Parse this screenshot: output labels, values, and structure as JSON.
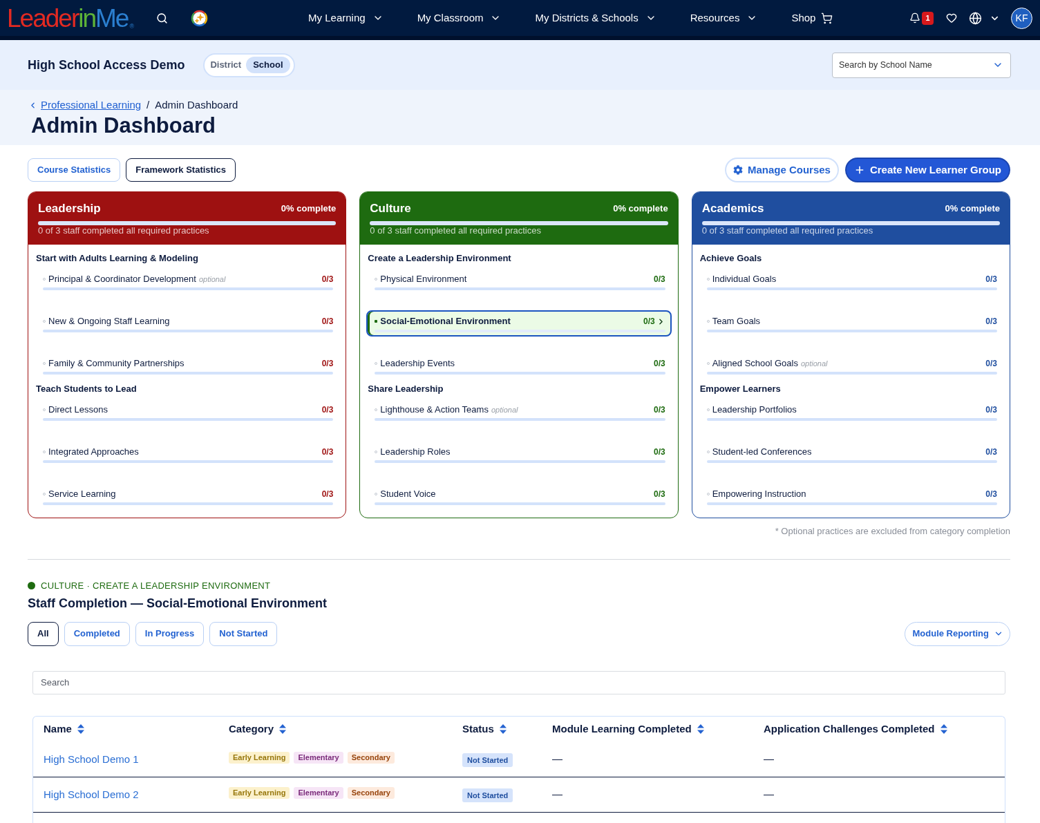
{
  "nav": {
    "logo": {
      "parts": [
        {
          "text": "Leader",
          "color": "#e32a22"
        },
        {
          "text": "in",
          "color": "#5db338"
        },
        {
          "text": "Me",
          "color": "#2b7fd0"
        }
      ],
      "mark": "®"
    },
    "menu": [
      {
        "label": "My Learning",
        "kind": "dropdown"
      },
      {
        "label": "My Classroom",
        "kind": "dropdown"
      },
      {
        "label": "My Districts & Schools",
        "kind": "dropdown"
      },
      {
        "label": "Resources",
        "kind": "dropdown"
      },
      {
        "label": "Shop",
        "kind": "cart"
      }
    ],
    "notifications": "1",
    "avatar": "KF"
  },
  "context": {
    "title": "High School Access Demo",
    "scope": [
      {
        "label": "District",
        "selected": false
      },
      {
        "label": "School",
        "selected": true
      }
    ],
    "school_search": {
      "placeholder": "Search by School Name"
    }
  },
  "breadcrumb": {
    "items": [
      {
        "label": "Professional Learning",
        "kind": "link"
      },
      {
        "label": "Admin Dashboard",
        "kind": "current"
      }
    ],
    "separator": "/"
  },
  "page_title": "Admin Dashboard",
  "view_tabs": [
    {
      "label": "Course Statistics",
      "selected": false
    },
    {
      "label": "Framework Statistics",
      "selected": true
    }
  ],
  "actions": [
    {
      "label": "Manage Courses",
      "kind": "secondary"
    },
    {
      "label": "Create New Learner Group",
      "kind": "primary"
    }
  ],
  "cards": [
    {
      "title": "Leadership",
      "color": "#9e1111",
      "completion": "0% complete",
      "level": 0,
      "summary": "0 of 3 staff completed all required practices",
      "sections": [
        {
          "heading": "Start with Adults Learning & Modeling",
          "practices": [
            {
              "name": "Principal & Coordinator Development",
              "note": "optional",
              "count": "0/3",
              "level": 0,
              "selected": false
            },
            {
              "name": "New & Ongoing Staff Learning",
              "count": "0/3",
              "level": 0,
              "selected": false
            },
            {
              "name": "Family & Community Partnerships",
              "count": "0/3",
              "level": 0,
              "selected": false
            }
          ]
        },
        {
          "heading": "Teach Students to Lead",
          "practices": [
            {
              "name": "Direct Lessons",
              "count": "0/3",
              "level": 0,
              "selected": false
            },
            {
              "name": "Integrated Approaches",
              "count": "0/3",
              "level": 0,
              "selected": false
            },
            {
              "name": "Service Learning",
              "count": "0/3",
              "level": 0,
              "selected": false
            }
          ]
        }
      ]
    },
    {
      "title": "Culture",
      "color": "#1e6b10",
      "completion": "0% complete",
      "level": 0,
      "summary": "0 of 3 staff completed all required practices",
      "sections": [
        {
          "heading": "Create a Leadership Environment",
          "practices": [
            {
              "name": "Physical Environment",
              "count": "0/3",
              "level": 0,
              "selected": false
            },
            {
              "name": "Social-Emotional Environment",
              "count": "0/3",
              "level": 0,
              "selected": true
            },
            {
              "name": "Leadership Events",
              "count": "0/3",
              "level": 0,
              "selected": false
            }
          ]
        },
        {
          "heading": "Share Leadership",
          "practices": [
            {
              "name": "Lighthouse & Action Teams",
              "note": "optional",
              "count": "0/3",
              "level": 0,
              "selected": false
            },
            {
              "name": "Leadership Roles",
              "count": "0/3",
              "level": 0,
              "selected": false
            },
            {
              "name": "Student Voice",
              "count": "0/3",
              "level": 0,
              "selected": false
            }
          ]
        }
      ]
    },
    {
      "title": "Academics",
      "color": "#1f4e9f",
      "completion": "0% complete",
      "level": 0,
      "summary": "0 of 3 staff completed all required practices",
      "sections": [
        {
          "heading": "Achieve Goals",
          "practices": [
            {
              "name": "Individual Goals",
              "count": "0/3",
              "level": 0,
              "selected": false
            },
            {
              "name": "Team Goals",
              "count": "0/3",
              "level": 0,
              "selected": false
            },
            {
              "name": "Aligned School Goals",
              "note": "optional",
              "count": "0/3",
              "level": 0,
              "selected": false
            }
          ]
        },
        {
          "heading": "Empower Learners",
          "practices": [
            {
              "name": "Leadership Portfolios",
              "count": "0/3",
              "level": 0,
              "selected": false
            },
            {
              "name": "Student-led Conferences",
              "count": "0/3",
              "level": 0,
              "selected": false
            },
            {
              "name": "Empowering Instruction",
              "count": "0/3",
              "level": 0,
              "selected": false
            }
          ]
        }
      ]
    }
  ],
  "footnote": "* Optional practices are excluded from category completion",
  "detail": {
    "eyebrow": "CULTURE · CREATE A LEADERSHIP ENVIRONMENT",
    "title": "Staff Completion — Social-Emotional Environment",
    "filters": [
      {
        "label": "All",
        "selected": true
      },
      {
        "label": "Completed",
        "selected": false
      },
      {
        "label": "In Progress",
        "selected": false
      },
      {
        "label": "Not Started",
        "selected": false
      }
    ],
    "report_menu": "Module Reporting",
    "search": {
      "placeholder": "Search"
    },
    "table": {
      "columns": [
        "Name",
        "Category",
        "Status",
        "Module Learning Completed",
        "Application Challenges Completed"
      ],
      "rows": [
        {
          "name": "High School Demo 1",
          "tags": [
            {
              "label": "Early Learning",
              "color": "#fcf1cc"
            },
            {
              "label": "Elementary",
              "color": "#f6e5f6"
            },
            {
              "label": "Secondary",
              "color": "#fdeadd"
            }
          ],
          "status": "Not Started",
          "module": "—",
          "challenges": "—"
        },
        {
          "name": "High School Demo 2",
          "tags": [
            {
              "label": "Early Learning",
              "color": "#fcf1cc"
            },
            {
              "label": "Elementary",
              "color": "#f6e5f6"
            },
            {
              "label": "Secondary",
              "color": "#fdeadd"
            }
          ],
          "status": "Not Started",
          "module": "—",
          "challenges": "—"
        }
      ]
    }
  }
}
